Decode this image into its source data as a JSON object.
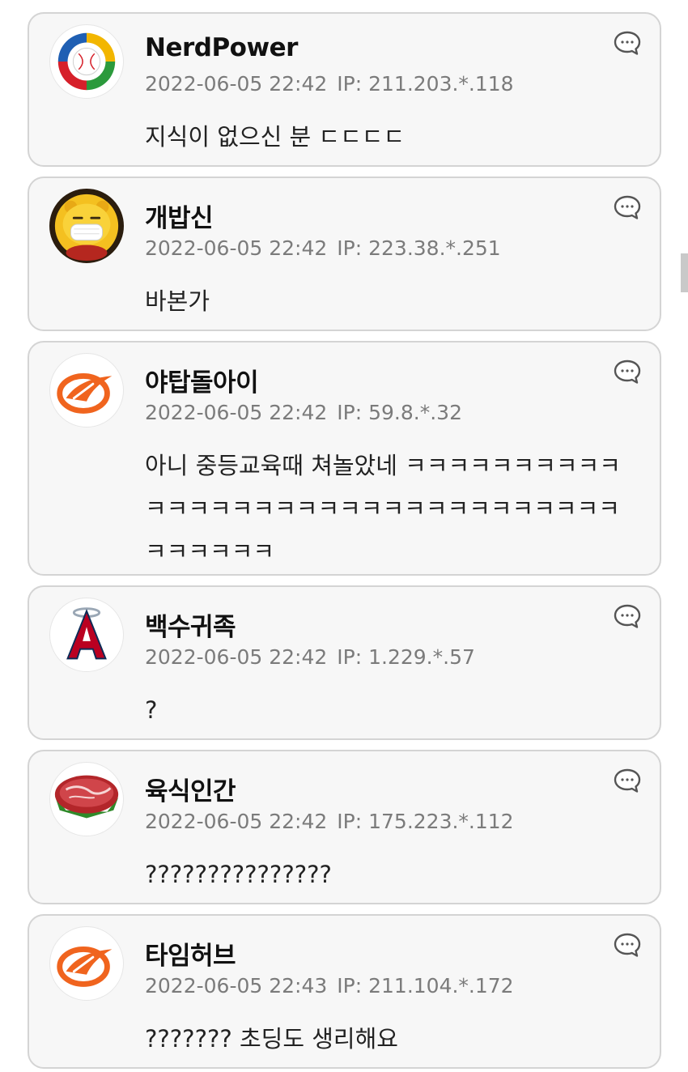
{
  "comments": [
    {
      "nickname": "NerdPower",
      "datetime": "2022-06-05 22:42",
      "ip": "IP: 211.203.*.118",
      "text": "지식이 없으신 분 ㄷㄷㄷㄷ",
      "avatar_icon": "baseball-logo-icon"
    },
    {
      "nickname": "개밥신",
      "datetime": "2022-06-05 22:42",
      "ip": "IP: 223.38.*.251",
      "text": "바본가",
      "avatar_icon": "masked-lion-character-icon"
    },
    {
      "nickname": "야탑돌아이",
      "datetime": "2022-06-05 22:42",
      "ip": "IP: 59.8.*.32",
      "text": "아니 중등교육때 쳐놀았네 ㅋㅋㅋㅋㅋㅋㅋㅋㅋㅋㅋㅋㅋㅋㅋㅋㅋㅋㅋㅋㅋㅋㅋㅋㅋㅋㅋㅋㅋㅋㅋㅋㅋㅋㅋㅋㅋㅋ",
      "avatar_icon": "orange-swoosh-logo-icon"
    },
    {
      "nickname": "백수귀족",
      "datetime": "2022-06-05 22:42",
      "ip": "IP: 1.229.*.57",
      "text": "?",
      "avatar_icon": "angels-a-logo-icon"
    },
    {
      "nickname": "육식인간",
      "datetime": "2022-06-05 22:42",
      "ip": "IP: 175.223.*.112",
      "text": "???????????????",
      "avatar_icon": "meat-steak-icon"
    },
    {
      "nickname": "타임허브",
      "datetime": "2022-06-05 22:43",
      "ip": "IP: 211.104.*.172",
      "text": "??????? 초딩도 생리해요",
      "avatar_icon": "orange-swoosh-logo-icon"
    }
  ],
  "reply_icon": "speech-bubble-icon",
  "colors": {
    "card_background": "#f7f7f7",
    "card_border": "#d4d4d4",
    "meta_text": "#7b7b7b",
    "body_text": "#222222",
    "accent_orange": "#f0641e"
  }
}
